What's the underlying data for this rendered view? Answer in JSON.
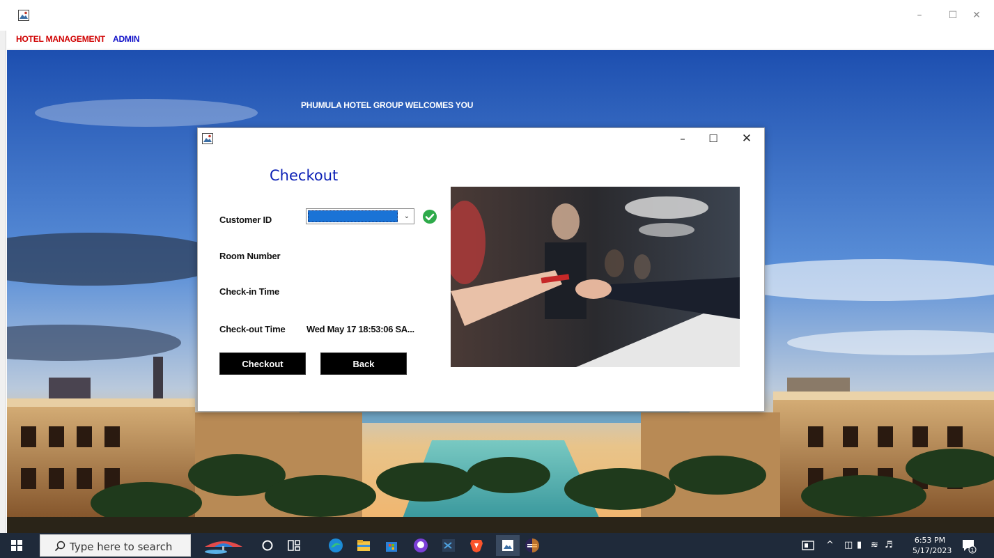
{
  "main_window": {
    "menu": [
      {
        "label": "HOTEL MANAGEMENT",
        "color": "#d00000"
      },
      {
        "label": "ADMIN",
        "color": "#1010c8"
      }
    ],
    "controls": {
      "minimize": "–",
      "maximize": "☐",
      "close": "✕"
    },
    "welcome_text": "PHUMULA HOTEL GROUP WELCOMES YOU"
  },
  "dialog": {
    "title": "Checkout",
    "title_color": "#0b1fb5",
    "controls": {
      "minimize": "–",
      "maximize": "☐",
      "close": "✕"
    },
    "labels": {
      "customer_id": "Customer ID",
      "room_number": "Room Number",
      "checkin_time": "Check-in Time",
      "checkout_time": "Check-out Time"
    },
    "checkout_time_value": "Wed May 17 18:53:06 SA...",
    "customer_id_selected": "",
    "buttons": {
      "checkout": "Checkout",
      "back": "Back"
    }
  },
  "taskbar": {
    "search_placeholder": "Type here to search",
    "time": "6:53 PM",
    "date": "5/17/2023",
    "apps": [
      "start-icon",
      "search-icon",
      "weather-widget-icon",
      "cortana-icon",
      "task-view-icon",
      "edge-icon",
      "file-explorer-icon",
      "microsoft-store-icon",
      "github-desktop-icon",
      "vscode-icon",
      "brave-icon",
      "java-app-icon",
      "eclipse-icon"
    ],
    "notification_count": "1"
  }
}
